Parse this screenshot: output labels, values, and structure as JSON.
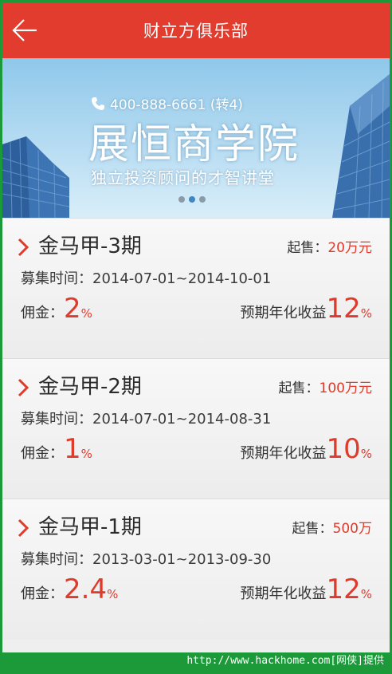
{
  "header": {
    "title": "财立方俱乐部",
    "back_icon": "arrow-left-icon"
  },
  "banner": {
    "phone_icon": "phone-icon",
    "phone": "400-888-6661 (转4)",
    "title": "展恒商学院",
    "subtitle": "独立投资顾问的才智讲堂",
    "dots_total": 3,
    "active_dot": 2
  },
  "products": [
    {
      "name": "金马甲-3期",
      "start_label": "起售：",
      "start_value": "20万元",
      "period": "募集时间：2014-07-01~2014-10-01",
      "commission_label": "佣金：",
      "commission_value": "2",
      "commission_unit": "%",
      "yield_label": "预期年化收益",
      "yield_value": "12",
      "yield_unit": "%"
    },
    {
      "name": "金马甲-2期",
      "start_label": "起售：",
      "start_value": "100万元",
      "period": "募集时间：2014-07-01~2014-08-31",
      "commission_label": "佣金：",
      "commission_value": "1",
      "commission_unit": "%",
      "yield_label": "预期年化收益",
      "yield_value": "10",
      "yield_unit": "%"
    },
    {
      "name": "金马甲-1期",
      "start_label": "起售：",
      "start_value": "500万",
      "period": "募集时间：2013-03-01~2013-09-30",
      "commission_label": "佣金：",
      "commission_value": "2.4",
      "commission_unit": "%",
      "yield_label": "预期年化收益",
      "yield_value": "12",
      "yield_unit": "%"
    }
  ],
  "footer": {
    "text": "http://www.hackhome.com[网侠]提供"
  },
  "colors": {
    "header": "#e23c2f",
    "accent": "#e03a2b",
    "footer": "#1c9a3a"
  }
}
